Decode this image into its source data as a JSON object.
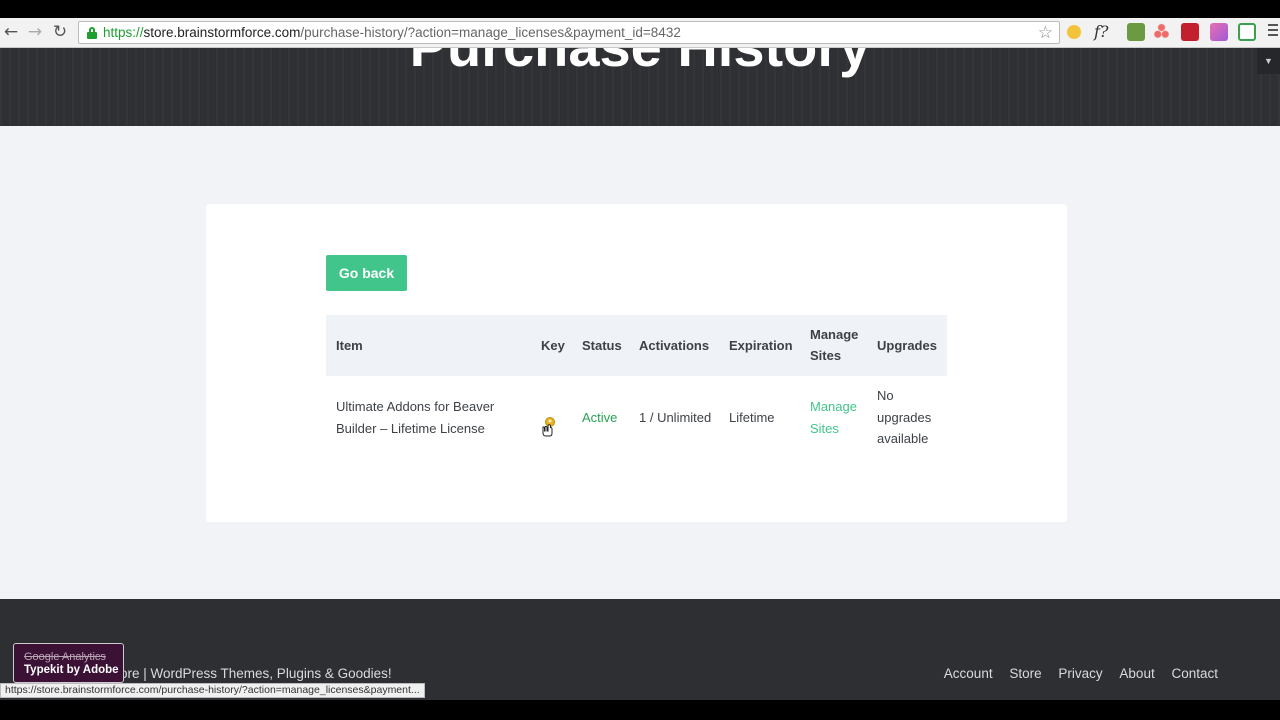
{
  "browser": {
    "url_scheme": "https://",
    "url_host": "store.brainstormforce.com",
    "url_path": "/purchase-history/?action=manage_licenses&payment_id=8432",
    "back_icon": "arrow-left-icon",
    "forward_icon": "arrow-right-icon",
    "reload_icon": "reload-icon",
    "bookmark_icon": "star-icon",
    "status_url": "https://store.brainstormforce.com/purchase-history/?action=manage_licenses&payment..."
  },
  "hero": {
    "title": "Purchase History"
  },
  "main": {
    "go_back_label": "Go back",
    "table": {
      "headers": {
        "item": "Item",
        "key": "Key",
        "status": "Status",
        "activations": "Activations",
        "expiration": "Expiration",
        "manage_line1": "Manage",
        "manage_line2": "Sites",
        "upgrades": "Upgrades"
      },
      "rows": [
        {
          "item_line1": "Ultimate Addons for Beaver",
          "item_line2": "Builder – Lifetime License",
          "key_icon": "key-icon",
          "status": "Active",
          "activations": "1 / Unlimited",
          "expiration": "Lifetime",
          "manage_line1": "Manage",
          "manage_line2": "Sites",
          "upgrades_line1": "No",
          "upgrades_line2": "upgrades",
          "upgrades_line3": "available"
        }
      ]
    }
  },
  "footer": {
    "left_text": "ore  |  WordPress Themes, Plugins & Goodies!",
    "links": [
      "Account",
      "Store",
      "Privacy",
      "About",
      "Contact"
    ]
  },
  "overlay": {
    "line1": "Google Analytics",
    "line2": "Typekit by Adobe"
  },
  "colors": {
    "accent_green": "#42c58a",
    "status_active": "#2aa152",
    "hero_bg": "#2f3033",
    "footer_bg": "#2e2f33"
  }
}
